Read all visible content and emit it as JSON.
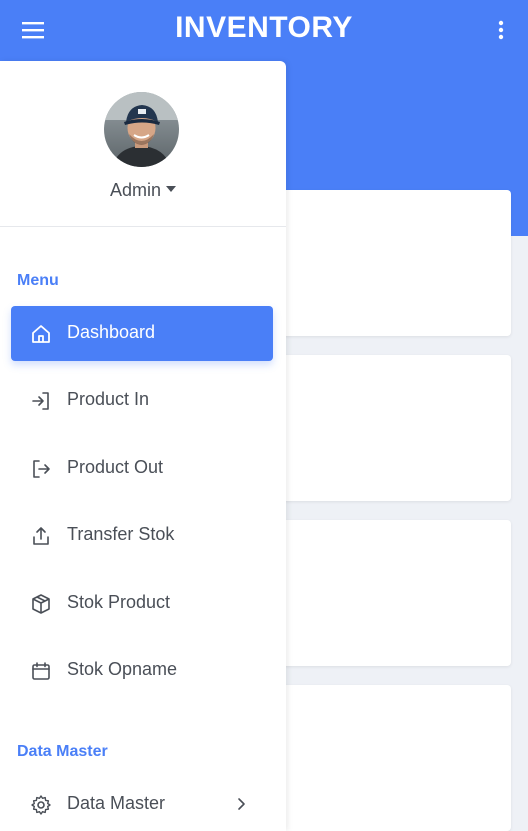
{
  "header": {
    "title": "INVENTORY",
    "menu_icon": "hamburger-icon",
    "more_icon": "kebab-icon",
    "color": "#4a7ff7"
  },
  "profile": {
    "name": "Admin",
    "avatar": "user-avatar"
  },
  "sections": {
    "menu": "Menu",
    "data_master": "Data Master"
  },
  "nav": {
    "dashboard": "Dashboard",
    "product_in": "Product In",
    "product_out": "Product Out",
    "transfer_stok": "Transfer Stok",
    "stok_product": "Stok Product",
    "stok_opname": "Stok Opname",
    "data_master": "Data Master"
  },
  "colors": {
    "accent": "#4a7ff7",
    "background": "#eef1f6",
    "text": "#4a4f57"
  }
}
